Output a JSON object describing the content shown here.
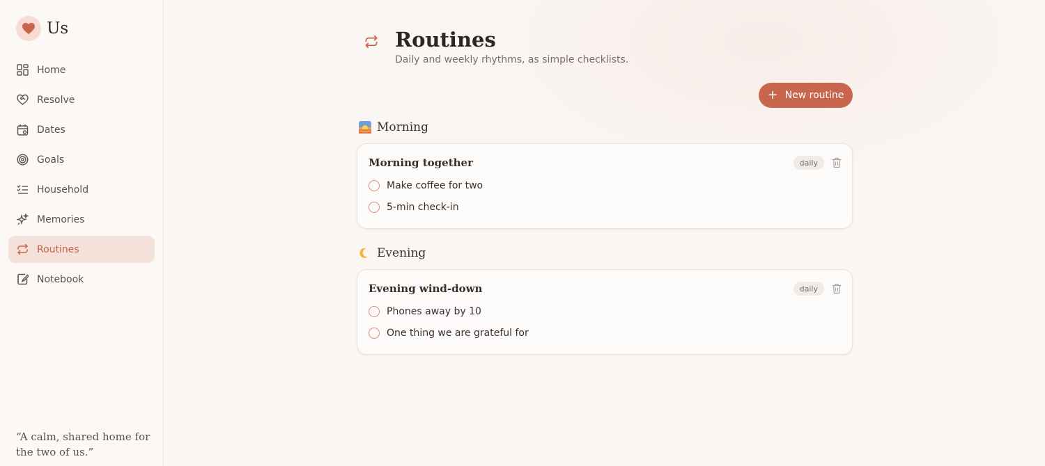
{
  "app": {
    "name": "Us",
    "quote": "“A calm, shared home for the two of us.”"
  },
  "sidebar": {
    "items": [
      {
        "label": "Home",
        "icon": "grid-icon",
        "active": false
      },
      {
        "label": "Resolve",
        "icon": "heart-handshake-icon",
        "active": false
      },
      {
        "label": "Dates",
        "icon": "calendar-icon",
        "active": false
      },
      {
        "label": "Goals",
        "icon": "target-icon",
        "active": false
      },
      {
        "label": "Household",
        "icon": "checklist-icon",
        "active": false
      },
      {
        "label": "Memories",
        "icon": "sparkles-icon",
        "active": false
      },
      {
        "label": "Routines",
        "icon": "repeat-icon",
        "active": true
      },
      {
        "label": "Notebook",
        "icon": "notebook-icon",
        "active": false
      }
    ]
  },
  "page": {
    "title": "Routines",
    "subtitle": "Daily and weekly rhythms, as simple checklists.",
    "new_button_label": "New routine"
  },
  "sections": [
    {
      "title": "Morning",
      "icon": "sunrise-icon",
      "routines": [
        {
          "title": "Morning together",
          "frequency": "daily",
          "tasks": [
            {
              "label": "Make coffee for two",
              "done": false
            },
            {
              "label": "5-min check-in",
              "done": false
            }
          ]
        }
      ]
    },
    {
      "title": "Evening",
      "icon": "crescent-moon-icon",
      "routines": [
        {
          "title": "Evening wind-down",
          "frequency": "daily",
          "tasks": [
            {
              "label": "Phones away by 10",
              "done": false
            },
            {
              "label": "One thing we are grateful for",
              "done": false
            }
          ]
        }
      ]
    }
  ],
  "colors": {
    "accent": "#c8664d",
    "active_bg": "#f4e1d9",
    "background": "#faf6f3"
  }
}
